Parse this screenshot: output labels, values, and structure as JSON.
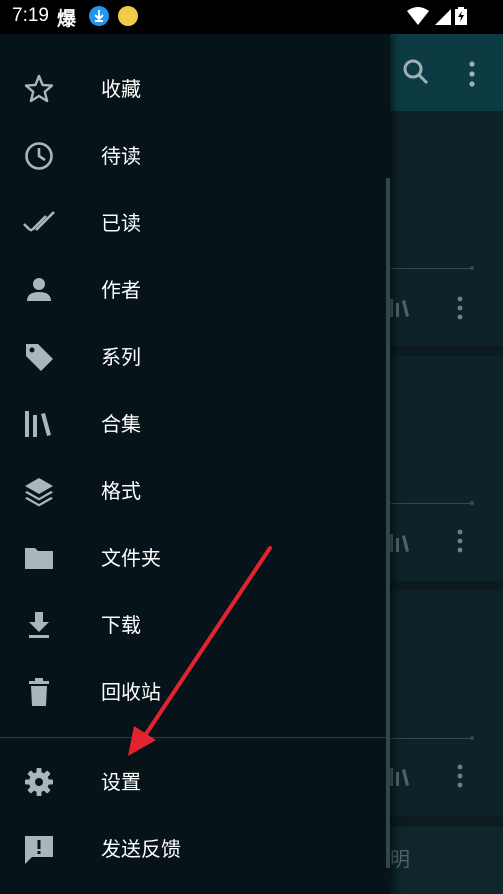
{
  "status_bar": {
    "time": "7:19",
    "notification_char": "爆"
  },
  "drawer": {
    "items": [
      {
        "label": "收藏",
        "icon": "star-outline-icon"
      },
      {
        "label": "待读",
        "icon": "clock-icon"
      },
      {
        "label": "已读",
        "icon": "done-all-icon"
      },
      {
        "label": "作者",
        "icon": "person-icon"
      },
      {
        "label": "系列",
        "icon": "tag-icon"
      },
      {
        "label": "合集",
        "icon": "library-icon"
      },
      {
        "label": "格式",
        "icon": "layers-icon"
      },
      {
        "label": "文件夹",
        "icon": "folder-icon"
      },
      {
        "label": "下载",
        "icon": "download-icon"
      },
      {
        "label": "回收站",
        "icon": "trash-icon"
      }
    ],
    "bottom_items": [
      {
        "label": "设置",
        "icon": "gear-icon"
      },
      {
        "label": "发送反馈",
        "icon": "feedback-icon"
      }
    ]
  },
  "background": {
    "bottom_tab_fragment": "明"
  },
  "colors": {
    "drawer_bg": "#061419",
    "appbar": "#0d3b44",
    "annotation_arrow": "#e3232f"
  }
}
